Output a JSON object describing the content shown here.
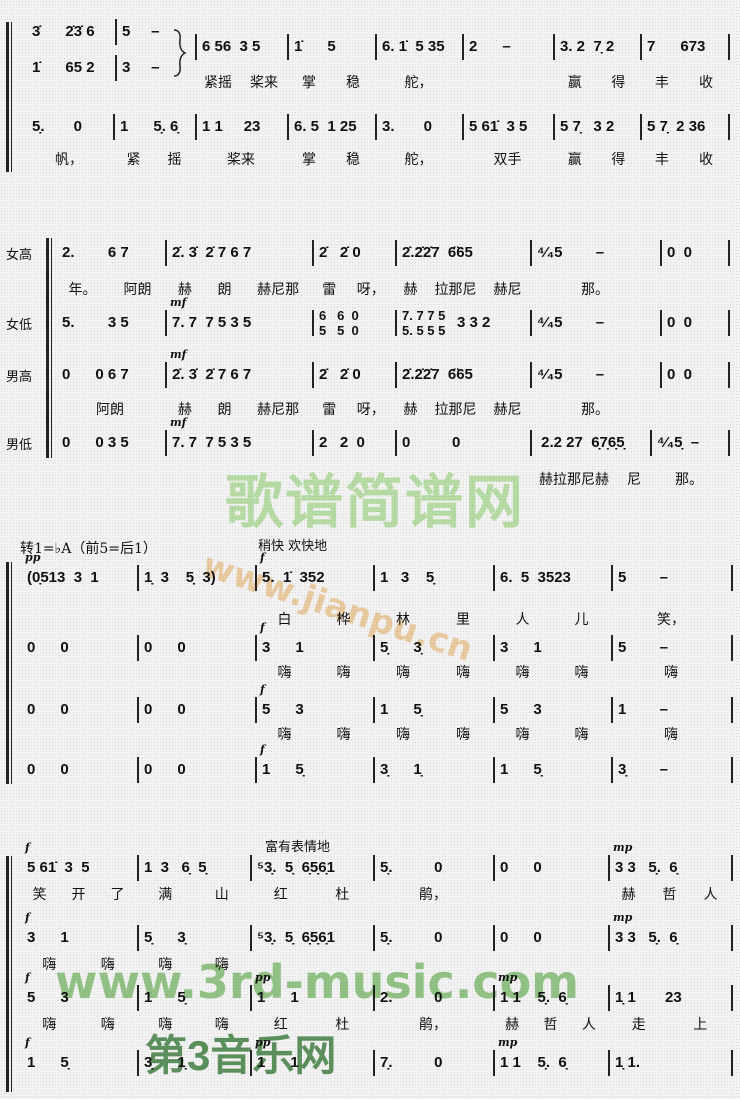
{
  "headers": {
    "key_change": "转1=♭A（前5=后1）",
    "tempo": "稍快  欢快地",
    "expression": "富有表情地"
  },
  "watermarks": {
    "site_cn": "歌谱简谱网",
    "site_url": "www.jianpu.cn",
    "site2_url": "www.3rd-music.com",
    "site2_cn": "第3音乐网"
  },
  "systems": [
    {
      "rows": [
        {
          "measures": [
            {
              "n": "3̇      2̇3̇ 6"
            },
            {
              "n": "5     –"
            }
          ]
        },
        {
          "measures": [
            {
              "n": "1̇      65 2"
            },
            {
              "n": "3     –"
            }
          ]
        },
        {
          "measures": [
            {
              "n": "6 56  3 5"
            },
            {
              "n": "1̇      5"
            },
            {
              "n": "6. 1̇  5 35"
            },
            {
              "n": "2      –"
            },
            {
              "n": "3. 2  7̣ 2"
            },
            {
              "n": "7      673"
            }
          ]
        },
        {
          "measures": [
            {
              "n": "5̣.       0"
            },
            {
              "n": "1      5̣. 6̣"
            },
            {
              "n": "1 1     23"
            },
            {
              "n": "6. 5  1 25"
            },
            {
              "n": "3.       0"
            },
            {
              "n": "5 61̇  3 5"
            },
            {
              "n": "5 7̣   3 2"
            },
            {
              "n": "5 7̣  2 36"
            }
          ]
        }
      ],
      "lyrics": [
        [
          [
            "紧摇",
            "桨来"
          ],
          [
            "掌",
            "稳"
          ],
          [
            "舵，"
          ],
          [],
          [
            "赢",
            "得"
          ],
          [
            "丰",
            "收"
          ]
        ],
        [
          [
            "帆，"
          ],
          [
            "紧",
            "摇"
          ],
          [
            "桨来"
          ],
          [
            "掌",
            "稳"
          ],
          [
            "舵，"
          ],
          [
            "双手"
          ],
          [
            "赢",
            "得"
          ],
          [
            "丰",
            "收"
          ]
        ]
      ]
    },
    {
      "rows": [
        {
          "label": "女高",
          "measures": [
            {
              "n": "2.        6 7"
            },
            {
              "n": "2̇. 3̇  2̇ 7 6 7"
            },
            {
              "n": "2̇   2̇ 0"
            },
            {
              "n": "2̇.2̇2̇7  6̈65"
            },
            {
              "n": "⁴⁄₄5        –"
            },
            {
              "n": "0  0"
            }
          ]
        },
        {
          "label": "女低",
          "measures": [
            {
              "n": "5.        3 5"
            },
            {
              "n": "7. 7  7 5 3 5",
              "dyn": "mf"
            },
            {
              "stack": [
                "6   6  0",
                "5   5  0"
              ]
            },
            {
              "stack": [
                "7. 7 7 5",
                "5. 5 5 5"
              ],
              "tail": "3 3 2"
            },
            {
              "n": "⁴⁄₄5        –"
            },
            {
              "n": "0  0"
            }
          ]
        },
        {
          "label": "男高",
          "measures": [
            {
              "n": "0      0 6 7"
            },
            {
              "n": "2̇. 3̇  2̇ 7 6 7",
              "dyn": "mf"
            },
            {
              "n": "2̇   2̇ 0"
            },
            {
              "n": "2̇.2̇2̇7  6̈65"
            },
            {
              "n": "⁴⁄₄5        –"
            },
            {
              "n": "0  0"
            }
          ]
        },
        {
          "label": "男低",
          "measures": [
            {
              "n": "0      0 3 5"
            },
            {
              "n": "7. 7  7 5 3 5",
              "dyn": "mf"
            },
            {
              "n": "2   2  0"
            },
            {
              "n": "0          0"
            },
            {
              "n": " 2.2 27  6̣7̣6̣5̣"
            },
            {
              "n": "⁴⁄₄5̣  –"
            }
          ]
        }
      ],
      "lyrics": [
        [
          [
            "年。",
            "阿朗"
          ],
          [
            "赫",
            "朗",
            "赫尼那"
          ],
          [
            "雷",
            "呀，"
          ],
          [
            "赫",
            "拉那尼",
            "赫尼"
          ],
          [
            "那。"
          ],
          []
        ],
        [
          [
            "阿朗"
          ],
          [
            "赫",
            "朗",
            "赫尼那"
          ],
          [
            "雷",
            "呀，"
          ],
          [
            "赫",
            "拉那尼",
            "赫尼"
          ],
          [
            "那。"
          ],
          []
        ],
        [
          [],
          [],
          [],
          [],
          [
            "赫拉那尼赫",
            "尼"
          ],
          [
            "那。"
          ]
        ]
      ]
    },
    {
      "rows": [
        {
          "measures": [
            {
              "n": "(0̣513  3  1",
              "dyn": "pp"
            },
            {
              "n": "1̣  3    5̣  3)"
            },
            {
              "n": "5.  1̇  352",
              "dyn": "f"
            },
            {
              "n": "1   3    5̣"
            },
            {
              "n": "6.  5  3523"
            },
            {
              "n": "5        –"
            }
          ]
        },
        {
          "measures": [
            {
              "n": "0      0"
            },
            {
              "n": "0      0"
            },
            {
              "n": "3      1",
              "dyn": "f"
            },
            {
              "n": "5̣      3̣"
            },
            {
              "n": "3      1"
            },
            {
              "n": "5        –"
            }
          ]
        },
        {
          "measures": [
            {
              "n": "0      0"
            },
            {
              "n": "0      0"
            },
            {
              "n": "5      3",
              "dyn": "f"
            },
            {
              "n": "1      5̣"
            },
            {
              "n": "5      3"
            },
            {
              "n": "1        –"
            }
          ]
        },
        {
          "measures": [
            {
              "n": "0      0"
            },
            {
              "n": "0      0"
            },
            {
              "n": "1      5̣",
              "dyn": "f"
            },
            {
              "n": "3̣      1̣"
            },
            {
              "n": "1      5̣"
            },
            {
              "n": "3̣        –"
            }
          ]
        }
      ],
      "lyrics": [
        [
          [],
          [],
          [
            "白",
            "桦"
          ],
          [
            "林",
            "里"
          ],
          [
            "人",
            "儿"
          ],
          [
            "笑，"
          ]
        ],
        [
          [],
          [],
          [
            "嗨",
            "嗨"
          ],
          [
            "嗨",
            "嗨"
          ],
          [
            "嗨",
            "嗨"
          ],
          [
            "嗨"
          ]
        ],
        [
          [],
          [],
          [
            "嗨",
            "嗨"
          ],
          [
            "嗨",
            "嗨"
          ],
          [
            "嗨",
            "嗨"
          ],
          [
            "嗨"
          ]
        ]
      ]
    },
    {
      "rows": [
        {
          "measures": [
            {
              "n": "5 61̇  3  5",
              "dyn": "f"
            },
            {
              "n": "1  3   6̣  5̣"
            },
            {
              "n": "⁵3̣.  5̣  6̣5̣6̣1"
            },
            {
              "n": "5̣.          0"
            },
            {
              "n": "0      0"
            },
            {
              "n": "3 3   5̣.  6̣",
              "dyn": "mp"
            }
          ]
        },
        {
          "measures": [
            {
              "n": "3      1",
              "dyn": "f"
            },
            {
              "n": "5̣      3̣"
            },
            {
              "n": "⁵3̣.  5̣  6̣5̣6̣1"
            },
            {
              "n": "5̣.          0"
            },
            {
              "n": "0      0"
            },
            {
              "n": "3 3   5̣.  6̣",
              "dyn": "mp"
            }
          ]
        },
        {
          "measures": [
            {
              "n": "5      3",
              "dyn": "f"
            },
            {
              "n": "1      5̣"
            },
            {
              "n": "1      1",
              "dyn": "pp"
            },
            {
              "n": "2.          0"
            },
            {
              "n": "1 1    5̣.  6̣",
              "dyn": "mp"
            },
            {
              "n": "1̣ 1       23"
            }
          ]
        },
        {
          "measures": [
            {
              "n": "1      5̣",
              "dyn": "f"
            },
            {
              "n": "3̣      1̣"
            },
            {
              "n": "1      1",
              "dyn": "pp"
            },
            {
              "n": "7̣.          0"
            },
            {
              "n": "1 1    5̣.  6̣",
              "dyn": "mp"
            },
            {
              "n": "1̣ 1."
            }
          ]
        }
      ],
      "lyrics": [
        [
          [
            "笑",
            "开",
            "了"
          ],
          [
            "满",
            "山"
          ],
          [
            "红",
            "杜"
          ],
          [
            "鹃，"
          ],
          [],
          [
            "赫",
            "哲",
            "人"
          ]
        ],
        [
          [
            "嗨",
            "嗨"
          ],
          [
            "嗨",
            "嗨"
          ],
          [],
          [],
          [],
          []
        ],
        [
          [
            "嗨",
            "嗨"
          ],
          [
            "嗨",
            "嗨"
          ],
          [
            "红",
            "杜"
          ],
          [
            "鹃，"
          ],
          [
            "赫",
            "哲",
            "人"
          ],
          [
            "走",
            "上"
          ]
        ]
      ]
    }
  ]
}
